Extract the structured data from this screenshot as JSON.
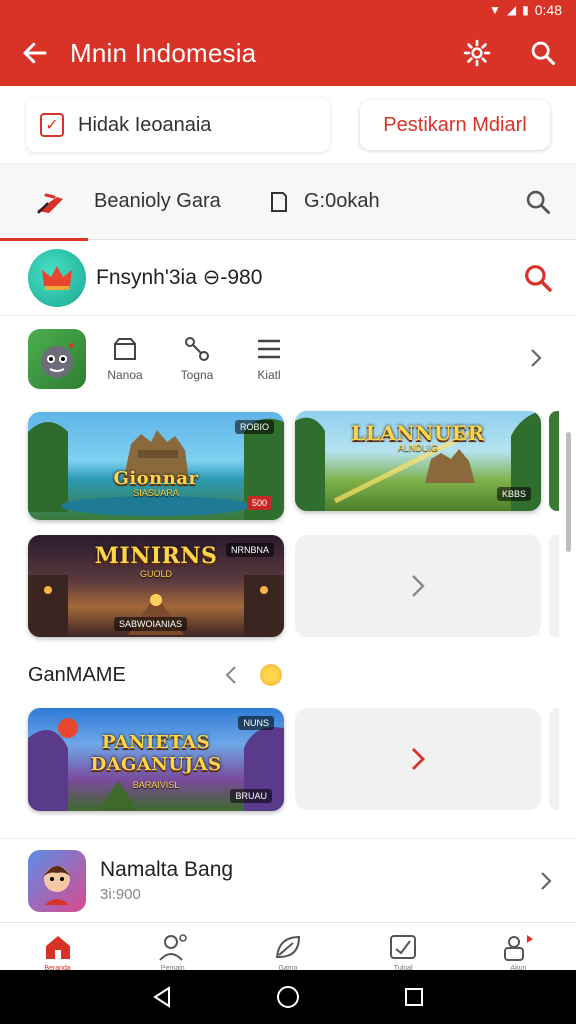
{
  "status_bar": {
    "time": "0:48"
  },
  "app_bar": {
    "title": "Mnin Indomesia",
    "back_icon": "arrow-left-icon",
    "settings_icon": "gear-icon",
    "search_icon": "search-icon"
  },
  "action_row": {
    "filter_label": "Hidak Ieoanaia",
    "cta_label": "Pestikarn Mdiarl"
  },
  "tabs": [
    {
      "label": "Beanioly Gara",
      "icon": "plane-icon"
    },
    {
      "label": "G:0okah",
      "icon": "book-icon"
    }
  ],
  "profile": {
    "name": "Fnsynh'3ia",
    "value": "⊖-980"
  },
  "categories": [
    {
      "label": "Nanoa",
      "icon": "box-icon"
    },
    {
      "label": "Togna",
      "icon": "link-icon"
    },
    {
      "label": "Kiatl",
      "icon": "menu-icon"
    }
  ],
  "cards": {
    "card1": {
      "title": "Gionnar",
      "sub": "SIASUARA",
      "badge": "500",
      "top_badge": "ROBIO"
    },
    "card2": {
      "title": "LLANNUER",
      "sub": "ALNDUIG",
      "badge": "KBBS"
    },
    "card3": {
      "title": "MINIRNS",
      "sub": "GUOLD",
      "badge": "SABWOIANIAS",
      "top_badge": "NRNBNA"
    },
    "card4": {
      "title": "PANIETAS DAGANUJAS",
      "sub": "BARAIVISL",
      "badge": "BRUAU",
      "top_badge": "NUNS"
    }
  },
  "section": {
    "title": "GanMAME"
  },
  "list_item": {
    "name": "Namalta Bang",
    "sub": "3i:900"
  },
  "bottom_nav": [
    {
      "label": "Beranda",
      "icon": "home-icon"
    },
    {
      "label": "Pemain",
      "icon": "person-icon"
    },
    {
      "label": "Gamo",
      "icon": "leaf-icon"
    },
    {
      "label": "Tuloal",
      "icon": "note-icon"
    },
    {
      "label": "Akun",
      "icon": "user-lock-icon"
    }
  ],
  "colors": {
    "accent": "#d93327",
    "background": "#ffffff",
    "placeholder": "#f1f1f1"
  }
}
